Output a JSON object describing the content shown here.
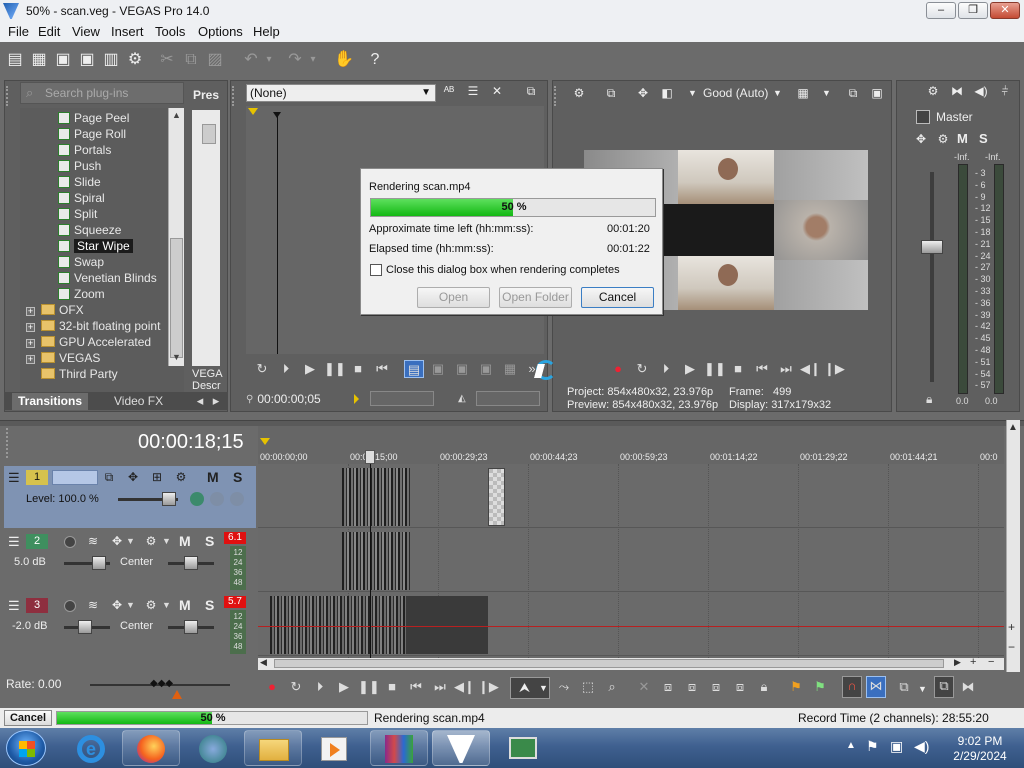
{
  "window": {
    "title": "50% - scan.veg - VEGAS Pro 14.0",
    "minimize": "0",
    "maximize": "1",
    "close": "r"
  },
  "menu": [
    "File",
    "Edit",
    "View",
    "Insert",
    "Tools",
    "Options",
    "Help"
  ],
  "explorer": {
    "search_placeholder": "Search plug-ins",
    "presets_label": "Pres",
    "vegas_label_1": "VEGA",
    "vegas_label_2": "Descr",
    "items": [
      "Page Peel",
      "Page Roll",
      "Portals",
      "Push",
      "Slide",
      "Spiral",
      "Split",
      "Squeeze",
      "Star Wipe",
      "Swap",
      "Venetian Blinds",
      "Zoom"
    ],
    "selected": "Star Wipe",
    "folders": [
      "OFX",
      "32-bit floating point",
      "GPU Accelerated",
      "VEGAS",
      "Third Party"
    ],
    "tabs": [
      "Transitions",
      "Video FX"
    ]
  },
  "trimmer": {
    "dropdown": "(None)",
    "timecode": "00:00:00;05"
  },
  "preview": {
    "quality": "Good (Auto)",
    "project_label": "Project:",
    "project": "854x480x32, 23.976p",
    "preview_label": "Preview:",
    "preview": "854x480x32, 23.976p",
    "frame_label": "Frame:",
    "frame": "499",
    "display_label": "Display:",
    "display": "317x179x32"
  },
  "master": {
    "label": "Master",
    "m": "M",
    "s": "S",
    "inf_left": "-Inf.",
    "inf_right": "-Inf.",
    "scale": [
      "3",
      "6",
      "9",
      "12",
      "15",
      "18",
      "21",
      "24",
      "27",
      "30",
      "33",
      "36",
      "39",
      "42",
      "45",
      "48",
      "51",
      "54",
      "57"
    ],
    "out_left": "0.0",
    "out_right": "0.0"
  },
  "dialog": {
    "title": "Rendering scan.mp4",
    "progress_text": "50 %",
    "progress": 0.5,
    "time_left_label": "Approximate time left (hh:mm:ss):",
    "time_left": "00:01:20",
    "elapsed_label": "Elapsed time (hh:mm:ss):",
    "elapsed": "00:01:22",
    "checkbox_label": "Close this dialog box when rendering completes",
    "btn_open": "Open",
    "btn_open_folder": "Open Folder",
    "btn_cancel": "Cancel"
  },
  "timeline": {
    "timecode": "00:00:18;15",
    "ruler": [
      "00:00:00;00",
      "00:00:15;00",
      "00:00:29;23",
      "00:00:44;23",
      "00:00:59;23",
      "00:01:14;22",
      "00:01:29;22",
      "00:01:44;21",
      "00:0"
    ],
    "tracks": [
      {
        "num": "1",
        "level_label": "Level: 100.0 %",
        "m": "M",
        "s": "S"
      },
      {
        "num": "2",
        "gain": "5.0 dB",
        "pan": "Center",
        "peak": "6.1",
        "m": "M",
        "s": "S",
        "meter": [
          "12",
          "24",
          "36",
          "48"
        ]
      },
      {
        "num": "3",
        "gain": "-2.0 dB",
        "pan": "Center",
        "peak": "5.7",
        "m": "M",
        "s": "S",
        "meter": [
          "12",
          "24",
          "36",
          "48"
        ]
      }
    ]
  },
  "transport": {
    "rate": "Rate: 0.00"
  },
  "status": {
    "cancel": "Cancel",
    "progress_text": "50 %",
    "progress": 0.5,
    "message": "Rendering scan.mp4",
    "record_time": "Record Time (2 channels): 28:55:20"
  },
  "taskbar": {
    "time": "9:02 PM",
    "date": "2/29/2024"
  }
}
